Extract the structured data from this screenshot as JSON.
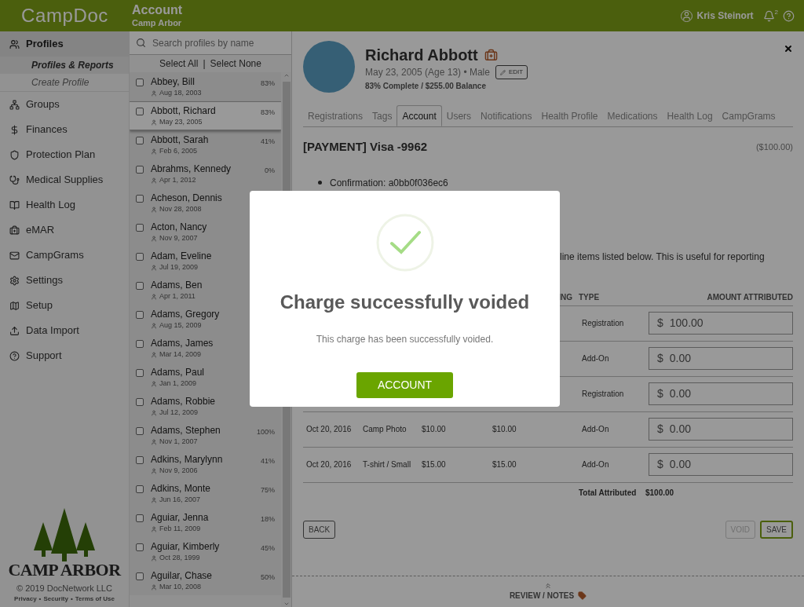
{
  "header": {
    "logo": "CampDoc",
    "title": "Account",
    "subtitle": "Camp Arbor",
    "user": "Kris Steinort",
    "notifications": "2"
  },
  "sidebar": {
    "items": [
      {
        "label": "Profiles",
        "selected": true,
        "children": [
          {
            "label": "Profiles & Reports",
            "selected": true
          },
          {
            "label": "Create Profile",
            "selected": false
          }
        ]
      },
      {
        "label": "Groups",
        "selected": false
      },
      {
        "label": "Finances",
        "selected": false
      },
      {
        "label": "Protection Plan",
        "selected": false
      },
      {
        "label": "Medical Supplies",
        "selected": false
      },
      {
        "label": "Health Log",
        "selected": false
      },
      {
        "label": "eMAR",
        "selected": false
      },
      {
        "label": "CampGrams",
        "selected": false
      },
      {
        "label": "Settings",
        "selected": false
      },
      {
        "label": "Setup",
        "selected": false
      },
      {
        "label": "Data Import",
        "selected": false
      },
      {
        "label": "Support",
        "selected": false
      }
    ],
    "brand": "CAMP ARBOR",
    "copyright": "© 2019 DocNetwork LLC",
    "links": [
      "Privacy",
      "Security",
      "Terms of Use"
    ],
    "separator": "•"
  },
  "profiles": {
    "search": {
      "placeholder": "Search profiles by name"
    },
    "select_all": "Select All",
    "divider": "|",
    "select_none": "Select None",
    "items": [
      {
        "name": "Abbey, Bill",
        "dob": "Aug 18, 2003",
        "pct": "83%",
        "selected": false,
        "checked": false
      },
      {
        "name": "Abbott, Richard",
        "dob": "May 23, 2005",
        "pct": "83%",
        "selected": true,
        "checked": false
      },
      {
        "name": "Abbott, Sarah",
        "dob": "Feb 6, 2005",
        "pct": "41%",
        "selected": false,
        "checked": false
      },
      {
        "name": "Abrahms, Kennedy",
        "dob": "Apr 1, 2012",
        "pct": "0%",
        "selected": false,
        "checked": false
      },
      {
        "name": "Acheson, Dennis",
        "dob": "Nov 28, 2008",
        "selected": false,
        "checked": false
      },
      {
        "name": "Acton, Nancy",
        "dob": "Nov 9, 2007",
        "selected": false,
        "checked": false
      },
      {
        "name": "Adam, Eveline",
        "dob": "Jul 19, 2009",
        "selected": false,
        "checked": false
      },
      {
        "name": "Adams, Ben",
        "dob": "Apr 1, 2011",
        "selected": false,
        "checked": false
      },
      {
        "name": "Adams, Gregory",
        "dob": "Aug 15, 2009",
        "selected": false,
        "checked": false
      },
      {
        "name": "Adams, James",
        "dob": "Mar 14, 2009",
        "selected": false,
        "checked": false
      },
      {
        "name": "Adams, Paul",
        "dob": "Jan 1, 2009",
        "selected": false,
        "checked": false
      },
      {
        "name": "Adams, Robbie",
        "dob": "Jul 12, 2009",
        "selected": false,
        "checked": false
      },
      {
        "name": "Adams, Stephen",
        "dob": "Nov 1, 2007",
        "pct": "100%",
        "selected": false,
        "checked": false
      },
      {
        "name": "Adkins, Marylynn",
        "dob": "Nov 9, 2006",
        "pct": "41%",
        "selected": false,
        "checked": false
      },
      {
        "name": "Adkins, Monte",
        "dob": "Jun 16, 2007",
        "pct": "75%",
        "selected": false,
        "checked": false
      },
      {
        "name": "Aguiar, Jenna",
        "dob": "Feb 11, 2009",
        "pct": "18%",
        "selected": false,
        "checked": false
      },
      {
        "name": "Aguiar, Kimberly",
        "dob": "Oct 28, 1999",
        "pct": "45%",
        "selected": false,
        "checked": false
      },
      {
        "name": "Aguilar, Chase",
        "dob": "Mar 10, 2008",
        "pct": "50%",
        "selected": false,
        "checked": false
      }
    ]
  },
  "profile": {
    "name": "Richard Abbott",
    "details": "May 23, 2005 (Age 13) • Male",
    "edit": "EDIT",
    "summary": "83% Complete / $255.00 Balance",
    "tabs": [
      {
        "label": "Registrations",
        "selected": false
      },
      {
        "label": "Tags",
        "selected": false
      },
      {
        "label": "Account",
        "selected": true
      },
      {
        "label": "Users",
        "selected": false
      },
      {
        "label": "Notifications",
        "selected": false
      },
      {
        "label": "Health Profile",
        "selected": false
      },
      {
        "label": "Medications",
        "selected": false
      },
      {
        "label": "Health Log",
        "selected": false
      },
      {
        "label": "CampGrams",
        "selected": false
      }
    ]
  },
  "payment": {
    "title": "[PAYMENT] Visa -9962",
    "amount": "($100.00)",
    "bullets": [
      "Confirmation: a0bb0f036ec6"
    ],
    "note": "line items listed below. This is useful for reporting",
    "table": {
      "column_4": "ING",
      "column_5": "TYPE",
      "column_6": "AMOUNT ATTRIBUTED",
      "rows": [
        {
          "type": "Registration",
          "currency": "$",
          "amount": "100.00"
        },
        {
          "type": "Add-On",
          "currency": "$",
          "amount": "0.00"
        },
        {
          "type": "Registration",
          "currency": "$",
          "amount": "0.00"
        },
        {
          "date": "Oct 20, 2016",
          "item": "Camp Photo",
          "price": "$10.00",
          "remaining": "$10.00",
          "type": "Add-On",
          "currency": "$",
          "amount": "0.00"
        },
        {
          "date": "Oct 20, 2016",
          "item": "T-shirt / Small",
          "price": "$15.00",
          "remaining": "$15.00",
          "type": "Add-On",
          "currency": "$",
          "amount": "0.00"
        }
      ],
      "total_label": "Total Attributed",
      "total": "$100.00"
    },
    "back": "BACK",
    "void": {
      "label": "VOID",
      "disabled": true
    },
    "save": "SAVE"
  },
  "footer": {
    "label": "REVIEW / NOTES"
  },
  "modal": {
    "title": "Charge successfully voided",
    "message": "This charge has been successfully voided.",
    "button": "ACCOUNT"
  }
}
